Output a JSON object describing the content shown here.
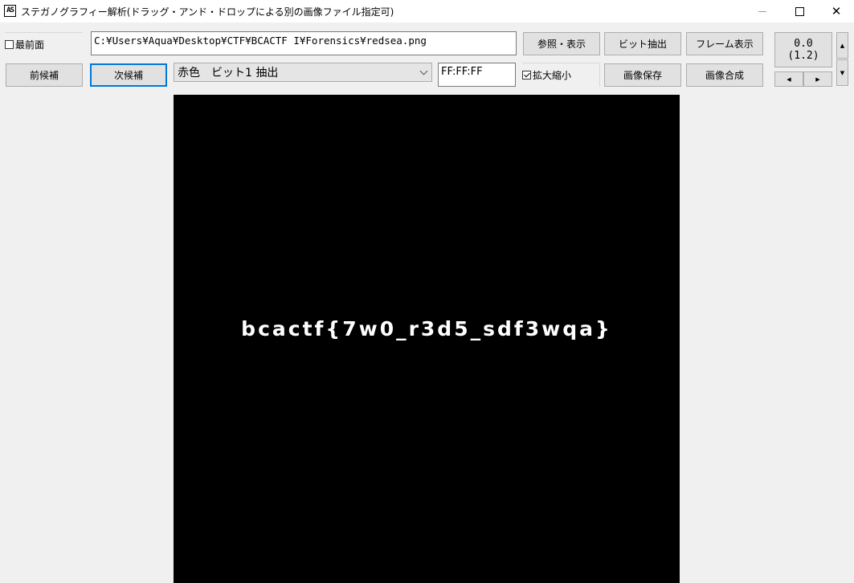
{
  "window": {
    "app_icon_text": "AS",
    "title": "ステガノグラフィー解析(ドラッグ・アンド・ドロップによる別の画像ファイル指定可)",
    "close_glyph": "✕"
  },
  "toolbar": {
    "topmost_label": "最前面",
    "topmost_checked": false,
    "file_path": "C:¥Users¥Aqua¥Desktop¥CTF¥BCACTF I¥Forensics¥redsea.png",
    "browse_label": "参照・表示",
    "bit_extract_label": "ビット抽出",
    "frame_show_label": "フレーム表示",
    "counter_value": "0.0",
    "counter_sub": "(1.2)",
    "prev_label": "前候補",
    "next_label": "次候補",
    "mode_selected": "赤色　ビット1 抽出",
    "color_value": "FF:FF:FF",
    "zoom_label": "拡大縮小",
    "zoom_checked": true,
    "save_label": "画像保存",
    "compose_label": "画像合成",
    "arrow_up": "▲",
    "arrow_down": "▼",
    "arrow_left": "◀",
    "arrow_right": "▶"
  },
  "image": {
    "flag_text": "bcactf{7w0_r3d5_sdf3wqa}"
  }
}
